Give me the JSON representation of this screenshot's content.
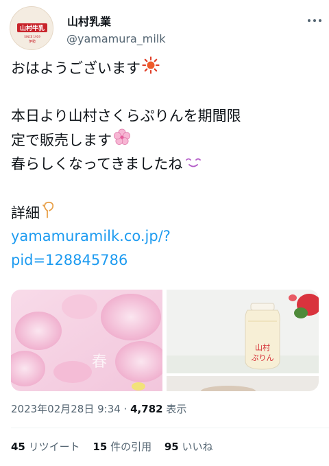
{
  "author": {
    "name": "山村乳業",
    "handle": "@yamamura_milk",
    "avatar_logo_text": "山村牛乳",
    "avatar_since": "SINCE 1919",
    "avatar_city": "伊勢"
  },
  "tweet": {
    "lines": [
      "おはようございます",
      "本日より山村さくらぷりんを期間限",
      "定で販売します",
      "春らしくなってきましたね",
      "詳細"
    ],
    "link_line1": "yamamuramilk.co.jp/?",
    "link_line2": "pid=128845786",
    "emojis": [
      "sun-emoji",
      "cherry-blossom-emoji",
      "smiling-face-emoji",
      "finger-pointing-down-emoji"
    ]
  },
  "media": {
    "left_overlay_text": "春",
    "bottle_label": "山村",
    "bottle_label2": "ぷりん"
  },
  "meta": {
    "datetime": "2023年02月28日 9:34",
    "separator": " · ",
    "views_count": "4,782",
    "views_label": " 表示"
  },
  "stats": {
    "retweets_count": "45",
    "retweets_label": " リツイート",
    "quotes_count": "15",
    "quotes_label": " 件の引用",
    "likes_count": "95",
    "likes_label": " いいね"
  },
  "colors": {
    "text": "#0f1419",
    "secondary": "#536471",
    "link": "#1d9bf0",
    "brand_red": "#c8242b"
  }
}
